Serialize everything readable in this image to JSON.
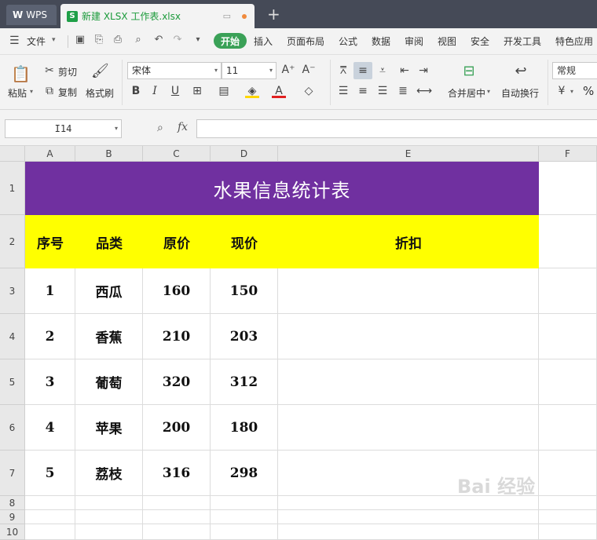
{
  "tabs": {
    "app_label": "WPS",
    "file_label": "新建 XLSX 工作表.xlsx",
    "file_icon_letter": "S",
    "new_tab": "+"
  },
  "menu": {
    "file_label": "文件",
    "items": [
      "开始",
      "插入",
      "页面布局",
      "公式",
      "数据",
      "审阅",
      "视图",
      "安全",
      "开发工具",
      "特色应用"
    ]
  },
  "ribbon": {
    "paste": "粘贴",
    "cut": "剪切",
    "copy": "复制",
    "format_painter": "格式刷",
    "font_name": "宋体",
    "font_size": "11",
    "merge_center": "合并居中",
    "wrap_text": "自动换行",
    "number_format": "常规",
    "percent": "%"
  },
  "formula_bar": {
    "cell_ref": "I14",
    "fx": "fx",
    "value": ""
  },
  "columns": [
    "A",
    "B",
    "C",
    "D",
    "E",
    "F"
  ],
  "rows": [
    "1",
    "2",
    "3",
    "4",
    "5",
    "6",
    "7",
    "8",
    "9",
    "10"
  ],
  "sheet": {
    "title": "水果信息统计表",
    "headers": [
      "序号",
      "品类",
      "原价",
      "现价",
      "折扣"
    ],
    "data": [
      [
        "1",
        "西瓜",
        "160",
        "150",
        ""
      ],
      [
        "2",
        "香蕉",
        "210",
        "203",
        ""
      ],
      [
        "3",
        "葡萄",
        "320",
        "312",
        ""
      ],
      [
        "4",
        "苹果",
        "200",
        "180",
        ""
      ],
      [
        "5",
        "荔枝",
        "316",
        "298",
        ""
      ]
    ]
  },
  "colors": {
    "title_fill": "#7030a0",
    "header_fill": "#ffff00",
    "accent_green": "#3aa157"
  },
  "watermark": "Bai 经验"
}
